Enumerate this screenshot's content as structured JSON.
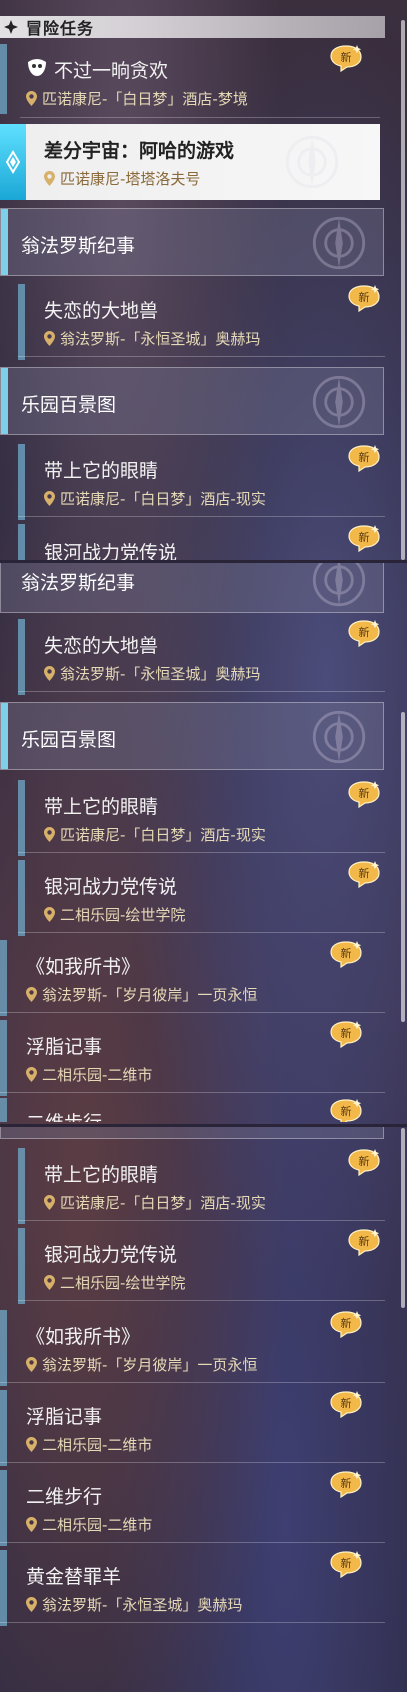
{
  "header": {
    "title": "冒险任务",
    "icon": "diamond-icon"
  },
  "colors": {
    "accent_blue": "#6fa9c9",
    "selected_cyan": "#3fcff0",
    "badge_gold": "#f2b84a",
    "location_text": "#e6d9b6"
  },
  "badge_label": "新",
  "panel1": {
    "quest1": {
      "title": "不过一晌贪欢",
      "location": "匹诺康尼-「白日梦」酒店-梦境",
      "icon": "mask-icon"
    },
    "selected_quest": {
      "title": "差分宇宙：阿哈的游戏",
      "location": "匹诺康尼-塔塔洛夫号",
      "icon": "diamond-icon"
    },
    "cat1": {
      "title": "翁法罗斯纪事"
    },
    "quest2": {
      "title": "失恋的大地兽",
      "location": "翁法罗斯-「永恒圣城」奥赫玛"
    },
    "cat2": {
      "title": "乐园百景图"
    },
    "quest3": {
      "title": "带上它的眼睛",
      "location": "匹诺康尼-「白日梦」酒店-现实"
    },
    "quest4_partial": {
      "title": "银河战力党传说"
    }
  },
  "panel2": {
    "cat1": {
      "title": "翁法罗斯纪事"
    },
    "quest1": {
      "title": "失恋的大地兽",
      "location": "翁法罗斯-「永恒圣城」奥赫玛"
    },
    "cat2": {
      "title": "乐园百景图"
    },
    "quest2": {
      "title": "带上它的眼睛",
      "location": "匹诺康尼-「白日梦」酒店-现实"
    },
    "quest3": {
      "title": "银河战力党传说",
      "location": "二相乐园-绘世学院"
    },
    "quest4": {
      "title": "《如我所书》",
      "location": "翁法罗斯-「岁月彼岸」一页永恒"
    },
    "quest5": {
      "title": "浮脂记事",
      "location": "二相乐园-二维市"
    },
    "quest6_partial": {
      "title": "二维步行"
    }
  },
  "panel3": {
    "quest1": {
      "title": "带上它的眼睛",
      "location": "匹诺康尼-「白日梦」酒店-现实"
    },
    "quest2": {
      "title": "银河战力党传说",
      "location": "二相乐园-绘世学院"
    },
    "quest3": {
      "title": "《如我所书》",
      "location": "翁法罗斯-「岁月彼岸」一页永恒"
    },
    "quest4": {
      "title": "浮脂记事",
      "location": "二相乐园-二维市"
    },
    "quest5": {
      "title": "二维步行",
      "location": "二相乐园-二维市"
    },
    "quest6": {
      "title": "黄金替罪羊",
      "location": "翁法罗斯-「永恒圣城」奥赫玛"
    }
  }
}
